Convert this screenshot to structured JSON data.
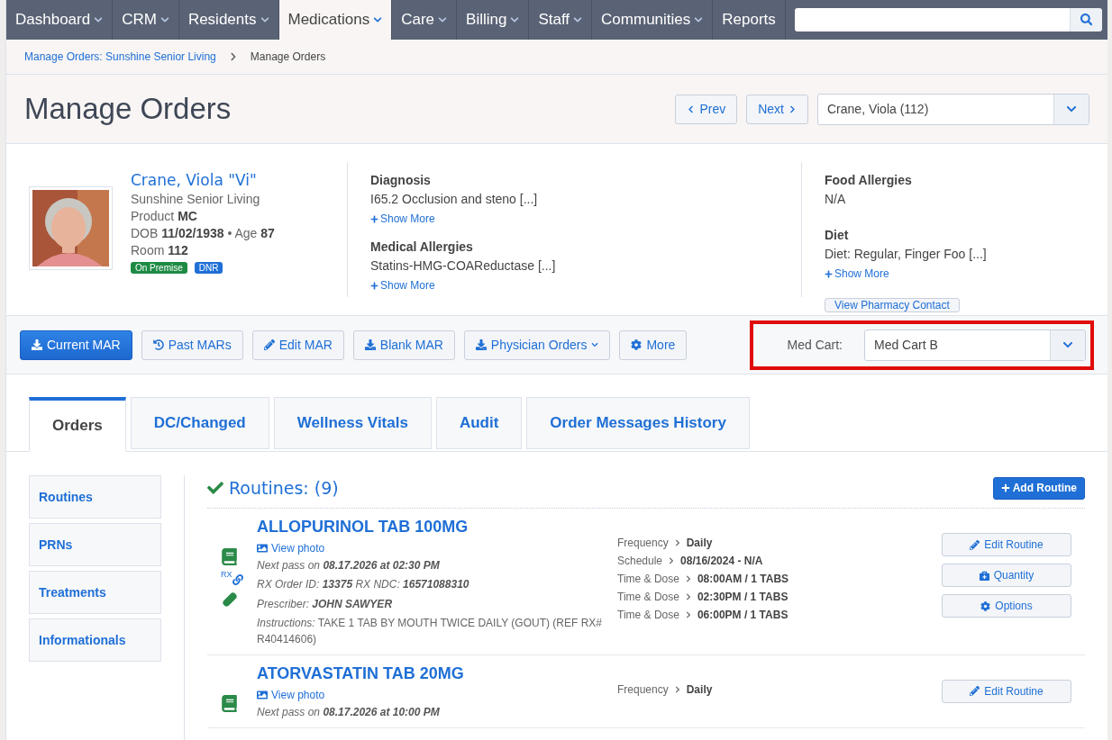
{
  "nav": {
    "items": [
      {
        "label": "Dashboard",
        "selected": false,
        "has_menu": true
      },
      {
        "label": "CRM",
        "selected": false,
        "has_menu": true
      },
      {
        "label": "Residents",
        "selected": false,
        "has_menu": true
      },
      {
        "label": "Medications",
        "selected": true,
        "has_menu": true
      },
      {
        "label": "Care",
        "selected": false,
        "has_menu": true
      },
      {
        "label": "Billing",
        "selected": false,
        "has_menu": true
      },
      {
        "label": "Staff",
        "selected": false,
        "has_menu": true
      },
      {
        "label": "Communities",
        "selected": false,
        "has_menu": true
      },
      {
        "label": "Reports",
        "selected": false,
        "has_menu": false
      }
    ]
  },
  "breadcrumb": [
    {
      "label": "Manage Orders: Sunshine Senior Living",
      "link": true
    },
    {
      "label": "Manage Orders",
      "link": false
    }
  ],
  "page_title": "Manage Orders",
  "pager": {
    "prev": "Prev",
    "next": "Next",
    "resident": "Crane, Viola (112)"
  },
  "resident": {
    "name": "Crane, Viola \"Vi\"",
    "community": "Sunshine Senior Living",
    "lines": [
      "Product **MC**",
      "DOB **11/02/1938**  •  Age **87**",
      "Room **112**"
    ],
    "badges": [
      {
        "label": "On Premise",
        "color": "#1e8a44"
      },
      {
        "label": "DNR",
        "color": "#1f6fd6"
      }
    ]
  },
  "info_columns": [
    {
      "blocks": [
        {
          "heading": "Diagnosis",
          "text": "I65.2 Occlusion and steno [...]",
          "show_more": "Show More"
        },
        {
          "heading": "Medical Allergies",
          "text": "Statins-HMG-COAReductase [...]",
          "show_more": "Show More"
        }
      ]
    },
    {
      "blocks": [
        {
          "heading": "Food Allergies",
          "text": "N/A"
        },
        {
          "heading": "Diet",
          "text": "Diet: Regular, Finger Foo [...]",
          "show_more": "Show More"
        }
      ],
      "button": "View Pharmacy Contact"
    }
  ],
  "toolbar": [
    {
      "label": "Current MAR",
      "kind": "download",
      "primary": true,
      "caret": false
    },
    {
      "label": "Past MARs",
      "kind": "history",
      "primary": false,
      "caret": false
    },
    {
      "label": "Edit MAR",
      "kind": "edit",
      "primary": false,
      "caret": false
    },
    {
      "label": "Blank MAR",
      "kind": "download",
      "primary": false,
      "caret": false
    },
    {
      "label": "Physician Orders",
      "kind": "download",
      "primary": false,
      "caret": true
    },
    {
      "label": "More",
      "kind": "settings",
      "primary": false,
      "caret": false
    }
  ],
  "med_cart": {
    "label": "Med Cart:",
    "value": "Med Cart B",
    "highlighted": true
  },
  "tabs": [
    {
      "label": "Orders",
      "selected": true
    },
    {
      "label": "DC/Changed",
      "selected": false
    },
    {
      "label": "Wellness Vitals",
      "selected": false
    },
    {
      "label": "Audit",
      "selected": false
    },
    {
      "label": "Order Messages History",
      "selected": false
    }
  ],
  "side_nav": [
    {
      "label": "Routines"
    },
    {
      "label": "PRNs"
    },
    {
      "label": "Treatments"
    },
    {
      "label": "Informationals"
    }
  ],
  "section": {
    "title": "Routines: (9)",
    "add_button": "Add Routine"
  },
  "orders": [
    {
      "name": "ALLOPURINOL TAB 100MG",
      "view_photo": "View photo",
      "icons": [
        {
          "kind": "book"
        },
        {
          "kind": "rx-link",
          "label": "RX"
        },
        {
          "kind": "pill"
        }
      ],
      "lines": [
        {
          "kind": "meta",
          "text": "Next pass on **08.17.2026 at 02:30 PM**"
        },
        {
          "kind": "meta",
          "text": "RX Order ID: **13375** RX NDC: **16571088310**"
        },
        {
          "kind": "meta",
          "text": "Prescriber: **JOHN SAWYER**"
        },
        {
          "kind": "note",
          "text": "*Instructions:* TAKE 1 TAB BY MOUTH TWICE DAILY (GOUT) (REF RX# R40414606)"
        }
      ],
      "schedule": [
        {
          "label": "Frequency",
          "value": "Daily"
        },
        {
          "label": "Schedule",
          "value": "08/16/2024 - N/A"
        },
        {
          "label": "Time & Dose",
          "value": "08:00AM / 1 TABS"
        },
        {
          "label": "Time & Dose",
          "value": "02:30PM / 1 TABS"
        },
        {
          "label": "Time & Dose",
          "value": "06:00PM / 1 TABS"
        }
      ],
      "actions": [
        {
          "label": "Edit Routine",
          "kind": "edit"
        },
        {
          "label": "Quantity",
          "kind": "quantity"
        },
        {
          "label": "Options",
          "kind": "settings"
        }
      ]
    },
    {
      "name": "ATORVASTATIN TAB 20MG",
      "view_photo": "View photo",
      "icons": [
        {
          "kind": "book"
        }
      ],
      "lines": [
        {
          "kind": "meta",
          "text": "Next pass on **08.17.2026 at 10:00 PM**"
        }
      ],
      "schedule": [
        {
          "label": "Frequency",
          "value": "Daily"
        }
      ],
      "actions": [
        {
          "label": "Edit Routine",
          "kind": "edit"
        }
      ]
    }
  ]
}
